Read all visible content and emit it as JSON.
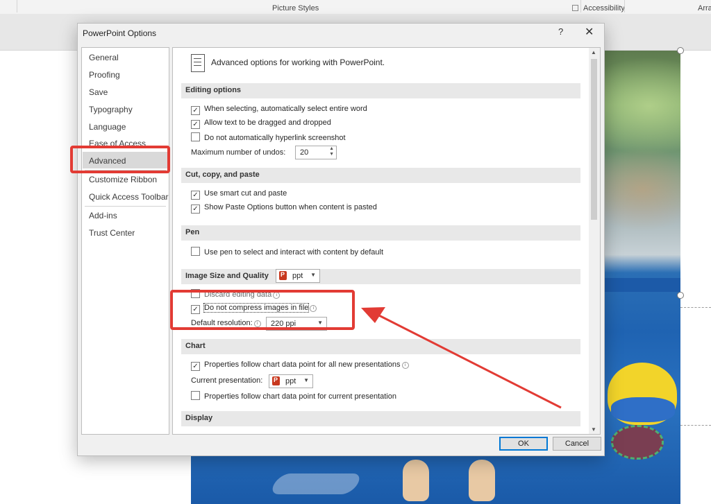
{
  "ribbon": {
    "group_picture_styles": "Picture Styles",
    "group_accessibility": "Accessibility",
    "group_arrange_partial": "Arra"
  },
  "dialog": {
    "title": "PowerPoint Options",
    "help": "?",
    "close": "✕",
    "nav": [
      {
        "label": "General"
      },
      {
        "label": "Proofing"
      },
      {
        "label": "Save"
      },
      {
        "label": "Typography"
      },
      {
        "label": "Language"
      },
      {
        "label": "Ease of Access"
      },
      {
        "label": "Advanced",
        "selected": true
      },
      {
        "label": "Customize Ribbon"
      },
      {
        "label": "Quick Access Toolbar"
      },
      {
        "label": "Add-ins"
      },
      {
        "label": "Trust Center"
      }
    ],
    "header": "Advanced options for working with PowerPoint.",
    "sections": {
      "editing": {
        "title": "Editing options",
        "opt1": "When selecting, automatically select entire word",
        "opt2": "Allow text to be dragged and dropped",
        "opt3": "Do not automatically hyperlink screenshot",
        "undos_label": "Maximum number of undos:",
        "undos_value": "20"
      },
      "cut": {
        "title": "Cut, copy, and paste",
        "opt1": "Use smart cut and paste",
        "opt2": "Show Paste Options button when content is pasted"
      },
      "pen": {
        "title": "Pen",
        "opt1": "Use pen to select and interact with content by default"
      },
      "image": {
        "title": "Image Size and Quality",
        "doc_value": "ppt",
        "opt1": "Discard editing data",
        "opt2": "Do not compress images in file",
        "resolution_label": "Default resolution:",
        "resolution_value": "220 ppi"
      },
      "chart": {
        "title": "Chart",
        "opt1": "Properties follow chart data point for all new presentations",
        "current_label": "Current presentation:",
        "current_value": "ppt",
        "opt2": "Properties follow chart data point for current presentation"
      },
      "display": {
        "title": "Display"
      }
    },
    "checks": {
      "editing_opt1": true,
      "editing_opt2": true,
      "editing_opt3": false,
      "cut_opt1": true,
      "cut_opt2": true,
      "pen_opt1": false,
      "image_opt1": false,
      "image_opt2": true,
      "chart_opt1": true,
      "chart_opt2": false
    },
    "buttons": {
      "ok": "OK",
      "cancel": "Cancel"
    }
  },
  "colors": {
    "annotation_red": "#e23b34",
    "accent": "#0078d4"
  }
}
